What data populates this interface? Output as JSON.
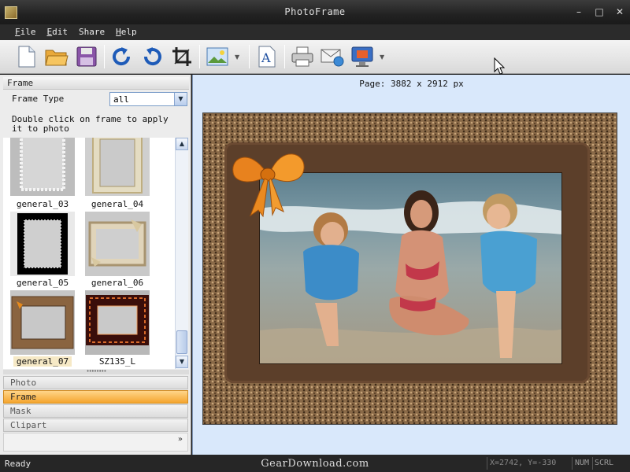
{
  "window": {
    "title": "PhotoFrame"
  },
  "menu": {
    "items": [
      {
        "ul": "F",
        "rest": "ile"
      },
      {
        "ul": "E",
        "rest": "dit"
      },
      {
        "ul": "",
        "rest": "Share"
      },
      {
        "ul": "H",
        "rest": "elp"
      }
    ]
  },
  "toolbar": {
    "icons": [
      "new-document-icon",
      "open-folder-icon",
      "save-disk-icon",
      "redo-icon",
      "undo-icon",
      "crop-icon",
      "image-icon",
      "add-text-icon",
      "printer-icon",
      "email-icon",
      "desktop-wallpaper-icon"
    ]
  },
  "left": {
    "header": "Frame",
    "frame_type_label": "Frame Type",
    "frame_type_value": "all",
    "hint": "Double click on frame to apply it to photo",
    "thumbs": [
      "general_03",
      "general_04",
      "general_05",
      "general_06",
      "general_07",
      "SZ135_L"
    ],
    "selected_thumb": "general_07",
    "nav": [
      "Photo",
      "Frame",
      "Mask",
      "Clipart"
    ],
    "active_nav": "Frame",
    "more": "»"
  },
  "canvas": {
    "page_label": "Page: 3882 x 2912 px"
  },
  "status": {
    "ready": "Ready",
    "watermark": "GearDownload.com",
    "coords": "X=2742, Y=-330",
    "num": "NUM",
    "scrl": "SCRL"
  },
  "colors": {
    "accent_nav": "#f5a52e",
    "canvas_bg": "#d9e8fb",
    "frame_brown": "#5c3f2a"
  }
}
